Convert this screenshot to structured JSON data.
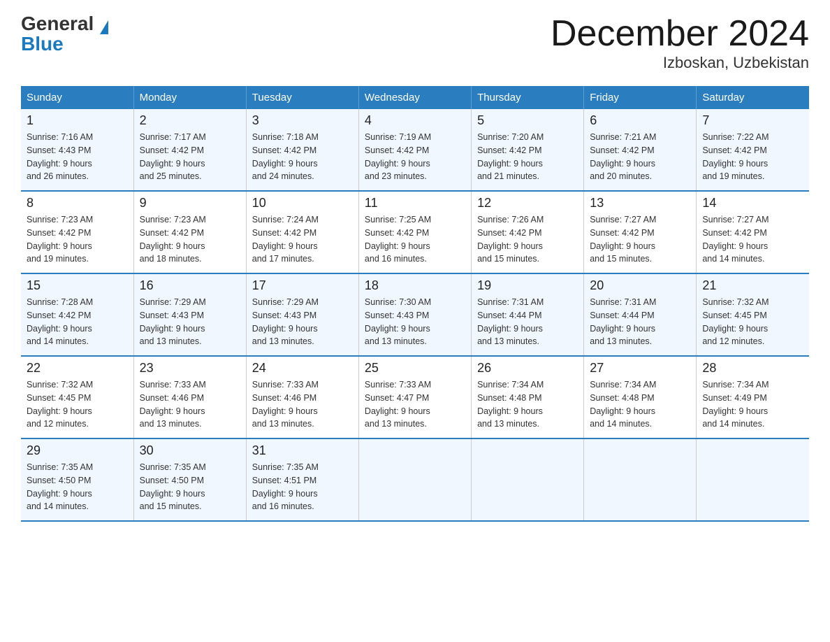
{
  "header": {
    "logo_general": "General",
    "logo_blue": "Blue",
    "month_title": "December 2024",
    "location": "Izboskan, Uzbekistan"
  },
  "days_of_week": [
    "Sunday",
    "Monday",
    "Tuesday",
    "Wednesday",
    "Thursday",
    "Friday",
    "Saturday"
  ],
  "weeks": [
    [
      {
        "day": "1",
        "sunrise": "7:16 AM",
        "sunset": "4:43 PM",
        "daylight": "9 hours and 26 minutes."
      },
      {
        "day": "2",
        "sunrise": "7:17 AM",
        "sunset": "4:42 PM",
        "daylight": "9 hours and 25 minutes."
      },
      {
        "day": "3",
        "sunrise": "7:18 AM",
        "sunset": "4:42 PM",
        "daylight": "9 hours and 24 minutes."
      },
      {
        "day": "4",
        "sunrise": "7:19 AM",
        "sunset": "4:42 PM",
        "daylight": "9 hours and 23 minutes."
      },
      {
        "day": "5",
        "sunrise": "7:20 AM",
        "sunset": "4:42 PM",
        "daylight": "9 hours and 21 minutes."
      },
      {
        "day": "6",
        "sunrise": "7:21 AM",
        "sunset": "4:42 PM",
        "daylight": "9 hours and 20 minutes."
      },
      {
        "day": "7",
        "sunrise": "7:22 AM",
        "sunset": "4:42 PM",
        "daylight": "9 hours and 19 minutes."
      }
    ],
    [
      {
        "day": "8",
        "sunrise": "7:23 AM",
        "sunset": "4:42 PM",
        "daylight": "9 hours and 19 minutes."
      },
      {
        "day": "9",
        "sunrise": "7:23 AM",
        "sunset": "4:42 PM",
        "daylight": "9 hours and 18 minutes."
      },
      {
        "day": "10",
        "sunrise": "7:24 AM",
        "sunset": "4:42 PM",
        "daylight": "9 hours and 17 minutes."
      },
      {
        "day": "11",
        "sunrise": "7:25 AM",
        "sunset": "4:42 PM",
        "daylight": "9 hours and 16 minutes."
      },
      {
        "day": "12",
        "sunrise": "7:26 AM",
        "sunset": "4:42 PM",
        "daylight": "9 hours and 15 minutes."
      },
      {
        "day": "13",
        "sunrise": "7:27 AM",
        "sunset": "4:42 PM",
        "daylight": "9 hours and 15 minutes."
      },
      {
        "day": "14",
        "sunrise": "7:27 AM",
        "sunset": "4:42 PM",
        "daylight": "9 hours and 14 minutes."
      }
    ],
    [
      {
        "day": "15",
        "sunrise": "7:28 AM",
        "sunset": "4:42 PM",
        "daylight": "9 hours and 14 minutes."
      },
      {
        "day": "16",
        "sunrise": "7:29 AM",
        "sunset": "4:43 PM",
        "daylight": "9 hours and 13 minutes."
      },
      {
        "day": "17",
        "sunrise": "7:29 AM",
        "sunset": "4:43 PM",
        "daylight": "9 hours and 13 minutes."
      },
      {
        "day": "18",
        "sunrise": "7:30 AM",
        "sunset": "4:43 PM",
        "daylight": "9 hours and 13 minutes."
      },
      {
        "day": "19",
        "sunrise": "7:31 AM",
        "sunset": "4:44 PM",
        "daylight": "9 hours and 13 minutes."
      },
      {
        "day": "20",
        "sunrise": "7:31 AM",
        "sunset": "4:44 PM",
        "daylight": "9 hours and 13 minutes."
      },
      {
        "day": "21",
        "sunrise": "7:32 AM",
        "sunset": "4:45 PM",
        "daylight": "9 hours and 12 minutes."
      }
    ],
    [
      {
        "day": "22",
        "sunrise": "7:32 AM",
        "sunset": "4:45 PM",
        "daylight": "9 hours and 12 minutes."
      },
      {
        "day": "23",
        "sunrise": "7:33 AM",
        "sunset": "4:46 PM",
        "daylight": "9 hours and 13 minutes."
      },
      {
        "day": "24",
        "sunrise": "7:33 AM",
        "sunset": "4:46 PM",
        "daylight": "9 hours and 13 minutes."
      },
      {
        "day": "25",
        "sunrise": "7:33 AM",
        "sunset": "4:47 PM",
        "daylight": "9 hours and 13 minutes."
      },
      {
        "day": "26",
        "sunrise": "7:34 AM",
        "sunset": "4:48 PM",
        "daylight": "9 hours and 13 minutes."
      },
      {
        "day": "27",
        "sunrise": "7:34 AM",
        "sunset": "4:48 PM",
        "daylight": "9 hours and 14 minutes."
      },
      {
        "day": "28",
        "sunrise": "7:34 AM",
        "sunset": "4:49 PM",
        "daylight": "9 hours and 14 minutes."
      }
    ],
    [
      {
        "day": "29",
        "sunrise": "7:35 AM",
        "sunset": "4:50 PM",
        "daylight": "9 hours and 14 minutes."
      },
      {
        "day": "30",
        "sunrise": "7:35 AM",
        "sunset": "4:50 PM",
        "daylight": "9 hours and 15 minutes."
      },
      {
        "day": "31",
        "sunrise": "7:35 AM",
        "sunset": "4:51 PM",
        "daylight": "9 hours and 16 minutes."
      },
      null,
      null,
      null,
      null
    ]
  ],
  "labels": {
    "sunrise": "Sunrise:",
    "sunset": "Sunset:",
    "daylight": "Daylight:"
  }
}
